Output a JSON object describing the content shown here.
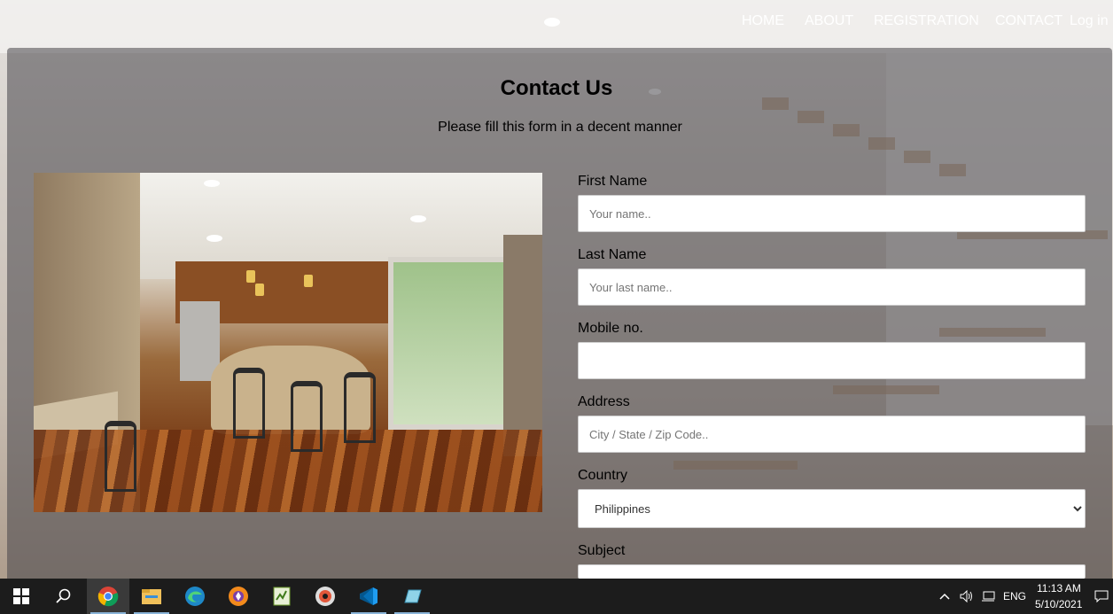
{
  "nav": {
    "items": [
      {
        "label": "HOME"
      },
      {
        "label": "ABOUT"
      },
      {
        "label": "REGISTRATION"
      },
      {
        "label": "CONTACT"
      }
    ],
    "login_label": "Log in"
  },
  "header": {
    "title": "Contact Us",
    "subtitle": "Please fill this form in a decent manner"
  },
  "form": {
    "first_name": {
      "label": "First Name",
      "placeholder": "Your name..",
      "value": ""
    },
    "last_name": {
      "label": "Last Name",
      "placeholder": "Your last name..",
      "value": ""
    },
    "mobile": {
      "label": "Mobile no.",
      "placeholder": "",
      "value": ""
    },
    "address": {
      "label": "Address",
      "placeholder": "City / State / Zip Code..",
      "value": ""
    },
    "country": {
      "label": "Country",
      "selected": "Philippines"
    },
    "subject": {
      "label": "Subject"
    }
  },
  "taskbar": {
    "apps": [
      "windows-start-icon",
      "search-icon",
      "chrome-icon",
      "file-explorer-icon",
      "edge-icon",
      "brave-icon",
      "notepad-plus-icon",
      "media-player-icon",
      "vscode-icon",
      "app-icon"
    ],
    "language": "ENG",
    "time": "11:13 AM",
    "date": "5/10/2021"
  }
}
